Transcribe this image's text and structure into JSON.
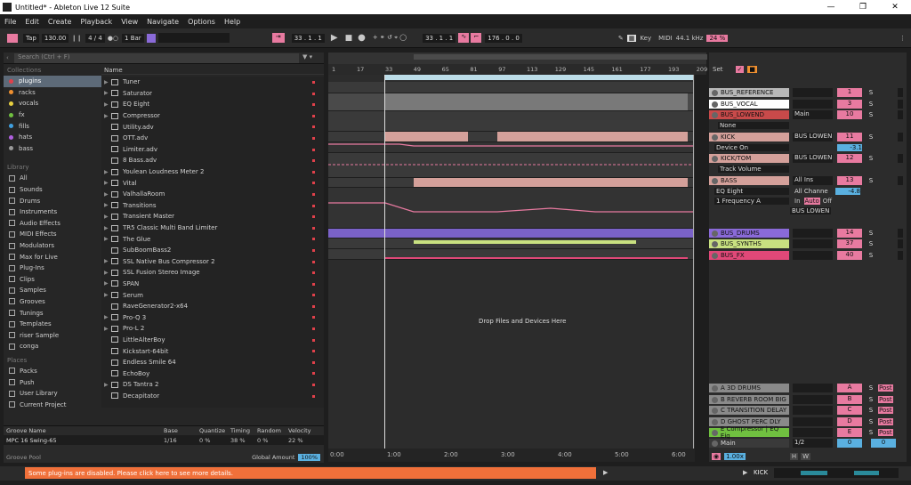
{
  "window": {
    "title": "Untitled* - Ableton Live 12 Suite"
  },
  "menu": [
    "File",
    "Edit",
    "Create",
    "Playback",
    "View",
    "Navigate",
    "Options",
    "Help"
  ],
  "transport": {
    "tap": "Tap",
    "tempo": "130.00",
    "sig": "4 / 4",
    "quant": "1 Bar",
    "pos": "33 .  1 .  1",
    "loop_start": "33 .  1 .  1",
    "loop_len": "176 .  0 .  0",
    "key": "Key",
    "midi": "MIDI",
    "sr": "44.1 kHz",
    "cpu": "24 %"
  },
  "browser": {
    "search_placeholder": "Search (Ctrl + F)",
    "name_header": "Name",
    "collections_label": "Collections",
    "collections": [
      {
        "label": "plugins",
        "color": "#e0404a"
      },
      {
        "label": "racks",
        "color": "#f09030"
      },
      {
        "label": "vocals",
        "color": "#e8d040"
      },
      {
        "label": "fx",
        "color": "#70c040"
      },
      {
        "label": "fills",
        "color": "#40a0e0"
      },
      {
        "label": "hats",
        "color": "#b060e0"
      },
      {
        "label": "bass",
        "color": "#999999"
      }
    ],
    "library_label": "Library",
    "library": [
      "All",
      "Sounds",
      "Drums",
      "Instruments",
      "Audio Effects",
      "MIDI Effects",
      "Modulators",
      "Max for Live",
      "Plug-Ins",
      "Clips",
      "Samples",
      "Grooves",
      "Tunings",
      "Templates",
      "riser Sample",
      "conga"
    ],
    "places_label": "Places",
    "places": [
      "Packs",
      "Push",
      "User Library",
      "Current Project"
    ],
    "items": [
      {
        "label": "Tuner",
        "folder": true
      },
      {
        "label": "Saturator",
        "folder": true
      },
      {
        "label": "EQ Eight",
        "folder": true
      },
      {
        "label": "Compressor",
        "folder": true
      },
      {
        "label": "Utility.adv",
        "folder": false
      },
      {
        "label": "OTT.adv",
        "folder": false
      },
      {
        "label": "Limiter.adv",
        "folder": false
      },
      {
        "label": "8 Bass.adv",
        "folder": false
      },
      {
        "label": "Youlean Loudness Meter 2",
        "folder": true
      },
      {
        "label": "Vital",
        "folder": true
      },
      {
        "label": "ValhallaRoom",
        "folder": true
      },
      {
        "label": "Transitions",
        "folder": true
      },
      {
        "label": "Transient Master",
        "folder": true
      },
      {
        "label": "TR5 Classic Multi Band Limiter",
        "folder": true
      },
      {
        "label": "The Glue",
        "folder": true
      },
      {
        "label": "SubBoomBass2",
        "folder": false
      },
      {
        "label": "SSL Native Bus Compressor 2",
        "folder": true
      },
      {
        "label": "SSL Fusion Stereo Image",
        "folder": true
      },
      {
        "label": "SPAN",
        "folder": true
      },
      {
        "label": "Serum",
        "folder": true
      },
      {
        "label": "RaveGenerator2-x64",
        "folder": false
      },
      {
        "label": "Pro-Q 3",
        "folder": true
      },
      {
        "label": "Pro-L 2",
        "folder": true
      },
      {
        "label": "LittleAlterBoy",
        "folder": false
      },
      {
        "label": "Kickstart-64bit",
        "folder": false
      },
      {
        "label": "Endless Smile 64",
        "folder": false
      },
      {
        "label": "EchoBoy",
        "folder": false
      },
      {
        "label": "DS Tantra 2",
        "folder": true
      },
      {
        "label": "Decapitator",
        "folder": false
      }
    ]
  },
  "groove": {
    "headers": [
      "Groove Name",
      "Base",
      "Quantize",
      "Timing",
      "Random",
      "Velocity"
    ],
    "name": "MPC 16 Swing-65",
    "base": "1/16",
    "quantize": "0 %",
    "timing": "38 %",
    "random": "0 %",
    "velocity": "22 %",
    "pool": "Groove Pool",
    "global_label": "Global Amount",
    "global_value": "100%"
  },
  "ruler": [
    "1",
    "17",
    "33",
    "49",
    "65",
    "81",
    "97",
    "113",
    "129",
    "145",
    "161",
    "177",
    "193",
    "209"
  ],
  "timeline": [
    "0:00",
    "1:00",
    "2:00",
    "3:00",
    "4:00",
    "5:00",
    "6:00"
  ],
  "drop_text": "Drop Files and Devices Here",
  "mixer": {
    "set_label": "Set",
    "tracks": [
      {
        "name": "BUS_REFERENCE",
        "color": "#b8b8b8",
        "io": "",
        "num": "1"
      },
      {
        "name": "BUS_VOCAL",
        "color": "#ffffff",
        "io": "",
        "num": "3"
      },
      {
        "name": "BUS_LOWEND",
        "color": "#c84a4a",
        "io": "Main",
        "num": "10"
      },
      {
        "name": "KICK",
        "color": "#d4a09a",
        "io": "BUS LOWEN",
        "num": "11"
      },
      {
        "name": "KICK/TOM",
        "color": "#d4a09a",
        "io": "BUS LOWEN",
        "num": "12"
      },
      {
        "name": "BASS",
        "color": "#d4a09a",
        "io": "All Ins",
        "num": "13"
      },
      {
        "name": "BUS_DRUMS",
        "color": "#8a6ad8",
        "io": "",
        "num": "14"
      },
      {
        "name": "BUS_SYNTHS",
        "color": "#c8e080",
        "io": "",
        "num": "37"
      },
      {
        "name": "BUS_FX",
        "color": "#e04878",
        "io": "",
        "num": "40"
      }
    ],
    "sub": {
      "none": "None",
      "device_on": "Device On",
      "device_val": "-3.1",
      "track_volume": "Track Volume",
      "eq": "EQ Eight",
      "freq": "1 Frequency A",
      "all_chan": "All Channe",
      "eq_val": "-4.8",
      "in": "In",
      "auto": "Auto",
      "off": "Off",
      "bus_lowen": "BUS LOWEN",
      "neg_inf": "-∞"
    },
    "returns": [
      {
        "name": "A 3D DRUMS",
        "num": "A"
      },
      {
        "name": "B REVERB ROOM BIG",
        "num": "B"
      },
      {
        "name": "C TRANSITION DELAY",
        "num": "C"
      },
      {
        "name": "D GHOST PERC DLY",
        "num": "D"
      },
      {
        "name": "E Compressor | EQ Eig",
        "num": "E"
      }
    ],
    "main": {
      "name": "Main",
      "io": "1/2",
      "num": "0"
    },
    "post": "Post",
    "zoom": "1.00x",
    "h": "H",
    "w": "W"
  },
  "status": {
    "warning": "Some plug-ins are disabled. Please click here to see more details.",
    "track": "KICK"
  }
}
